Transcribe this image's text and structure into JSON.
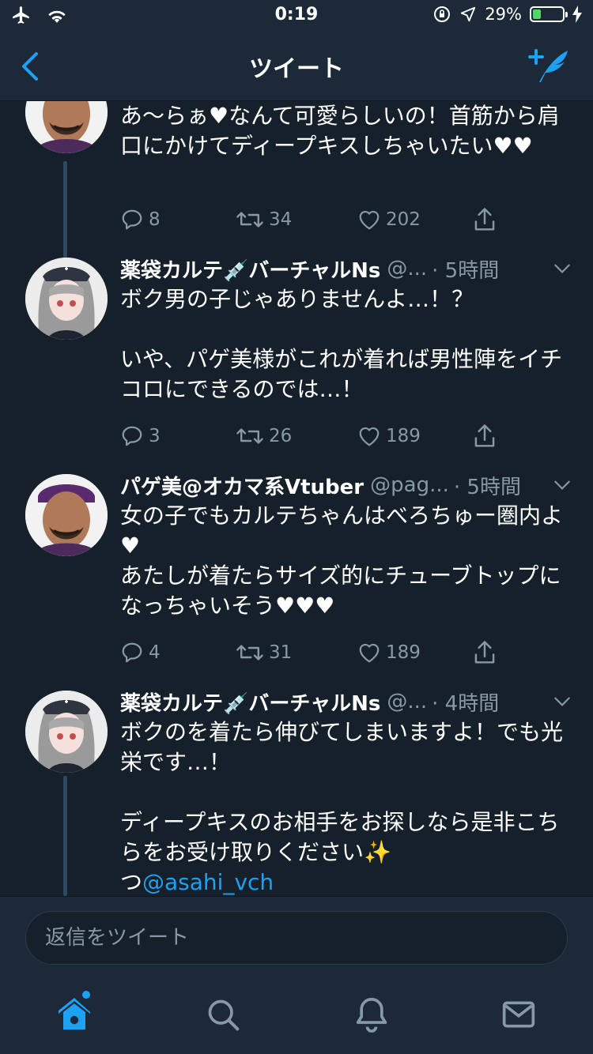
{
  "status_bar": {
    "time": "0:19",
    "battery": "29%",
    "battery_level": 0.29
  },
  "nav": {
    "title": "ツイート"
  },
  "tweets": [
    {
      "name": "",
      "handle": "",
      "time": "",
      "text": "あ〜らぁ♥なんて可愛らしいの！首筋から肩口にかけてディープキスしちゃいたい♥♥",
      "replies": "8",
      "retweets": "34",
      "likes": "202"
    },
    {
      "name": "薬袋カルテ💉バーチャルNs",
      "handle": "@...",
      "time": "· 5時間",
      "text": "ボク男の子じゃありませんよ…！？\n\nいや、パゲ美様がこれが着れば男性陣をイチコロにできるのでは…！",
      "replies": "3",
      "retweets": "26",
      "likes": "189"
    },
    {
      "name": "パゲ美@オカマ系Vtuber",
      "handle": "@pag...",
      "time": "· 5時間",
      "text": "女の子でもカルテちゃんはべろちゅー圏内よ♥\nあたしが着たらサイズ的にチューブトップになっちゃいそう♥♥♥",
      "replies": "4",
      "retweets": "31",
      "likes": "189"
    },
    {
      "name": "薬袋カルテ💉バーチャルNs",
      "handle": "@...",
      "time": "· 4時間",
      "text": "ボクのを着たら伸びてしまいますよ！でも光栄です…！\n\nディープキスのお相手をお探しなら是非こちらをお受け取りください✨",
      "text_prefix": "つ",
      "mention": "@asahi_vch"
    }
  ],
  "reply_bar": {
    "placeholder": "返信をツイート"
  },
  "tabs": [
    "home-icon",
    "search-icon",
    "bell-icon",
    "mail-icon"
  ],
  "colors": {
    "background": "#15202b",
    "bars": "#1c2938",
    "accent": "#1da1f2",
    "muted": "#8899a6"
  }
}
